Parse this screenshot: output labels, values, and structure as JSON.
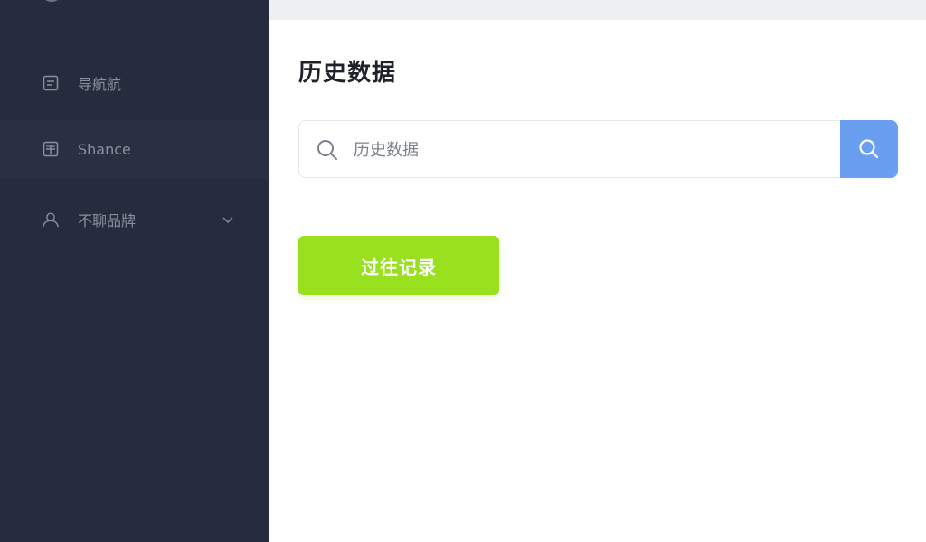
{
  "sidebar": {
    "items": [
      {
        "label": "导航航",
        "icon": "document-icon"
      },
      {
        "label": "Shance",
        "icon": "table-icon"
      },
      {
        "label": "不聊品牌",
        "icon": "user-icon"
      }
    ]
  },
  "main": {
    "title": "历史数据",
    "search": {
      "placeholder": "历史数据"
    },
    "history_button_label": "过往记录"
  },
  "colors": {
    "sidebar_bg": "#252c3d",
    "search_button": "#6a9ff0",
    "history_button": "#99e11f"
  }
}
